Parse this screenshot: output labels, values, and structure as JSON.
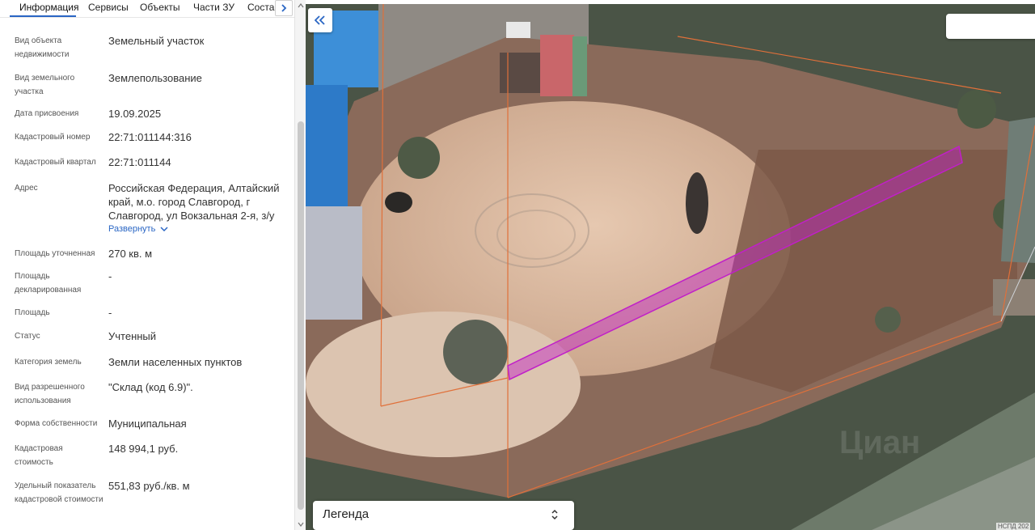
{
  "tabs": [
    {
      "label": "Информация",
      "active": true
    },
    {
      "label": "Сервисы",
      "active": false
    },
    {
      "label": "Объекты",
      "active": false
    },
    {
      "label": "Части ЗУ",
      "active": false
    },
    {
      "label": "Состав",
      "active": false
    }
  ],
  "info": {
    "object_type": {
      "label": "Вид объекта недвижимости",
      "value": "Земельный участок"
    },
    "land_type": {
      "label": "Вид земельного участка",
      "value": "Землепользование"
    },
    "assign_date": {
      "label": "Дата присвоения",
      "value": "19.09.2025"
    },
    "cadastral_number": {
      "label": "Кадастровый номер",
      "value": "22:71:011144:316"
    },
    "cadastral_quarter": {
      "label": "Кадастровый квартал",
      "value": "22:71:011144"
    },
    "address": {
      "label": "Адрес",
      "value": "Российская Федерация, Алтайский край, м.о. город Славгород, г Славгород, ул Вокзальная 2-я, з/у",
      "expand_label": "Развернуть"
    },
    "area_refined": {
      "label": "Площадь уточненная",
      "value": "270 кв. м"
    },
    "area_declared": {
      "label": "Площадь декларированная",
      "value": "-"
    },
    "area": {
      "label": "Площадь",
      "value": "-"
    },
    "status": {
      "label": "Статус",
      "value": "Учтенный"
    },
    "land_category": {
      "label": "Категория земель",
      "value": "Земли населенных пунктов"
    },
    "permitted_use": {
      "label": "Вид разрешенного использования",
      "value": "\"Склад (код 6.9)\"."
    },
    "ownership": {
      "label": "Форма собственности",
      "value": "Муниципальная"
    },
    "cadastral_value": {
      "label": "Кадастровая стоимость",
      "value": "148 994,1 руб."
    },
    "specific_value": {
      "label": "Удельный показатель кадастровой стоимости",
      "value": "551,83 руб./кв. м"
    }
  },
  "map": {
    "legend_label": "Легенда",
    "attribution": "НСПД 202",
    "highlight_color": "#c020c8",
    "boundary_color": "#e0703a"
  },
  "icons": {
    "collapse": "double-chevron-left-icon",
    "tab_scroll": "chevron-right-icon",
    "legend_toggle": "chevron-up-down-icon",
    "expand": "chevron-down-icon"
  }
}
